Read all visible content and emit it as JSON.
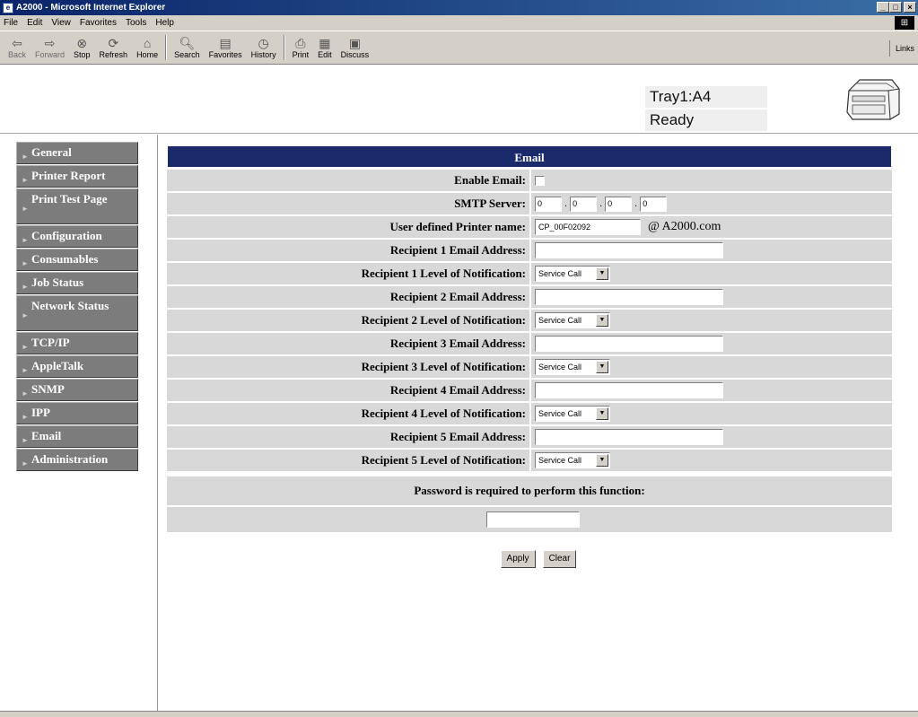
{
  "window": {
    "title": "A2000 - Microsoft Internet Explorer"
  },
  "menu": [
    "File",
    "Edit",
    "View",
    "Favorites",
    "Tools",
    "Help"
  ],
  "toolbar": {
    "buttons": [
      {
        "label": "Back",
        "icon": "back-arrow-icon"
      },
      {
        "label": "Forward",
        "icon": "forward-arrow-icon"
      },
      {
        "label": "Stop",
        "icon": "stop-icon"
      },
      {
        "label": "Refresh",
        "icon": "refresh-icon"
      },
      {
        "label": "Home",
        "icon": "home-icon"
      },
      {
        "label": "Search",
        "icon": "search-icon"
      },
      {
        "label": "Favorites",
        "icon": "favorites-icon"
      },
      {
        "label": "History",
        "icon": "history-icon"
      },
      {
        "label": "Print",
        "icon": "print-icon"
      },
      {
        "label": "Edit",
        "icon": "edit-icon"
      },
      {
        "label": "Discuss",
        "icon": "discuss-icon"
      }
    ],
    "links": "Links"
  },
  "status": {
    "tray": "Tray1:A4",
    "state": "Ready"
  },
  "nav": [
    "General",
    "Printer Report",
    "Print Test Page",
    "Configuration",
    "Consumables",
    "Job Status",
    "Network Status",
    "TCP/IP",
    "AppleTalk",
    "SNMP",
    "IPP",
    "Email",
    "Administration"
  ],
  "form": {
    "title": "Email",
    "enable_email_label": "Enable Email:",
    "smtp_label": "SMTP Server:",
    "smtp_octets": [
      "0",
      "0",
      "0",
      "0"
    ],
    "printer_name_label": "User defined Printer name:",
    "printer_name_value": "CP_00F02092",
    "domain": "@ A2000.com",
    "recipients": [
      {
        "address_label": "Recipient 1 Email Address:",
        "level_label": "Recipient 1 Level of Notification:",
        "level": "Service Call"
      },
      {
        "address_label": "Recipient 2 Email Address:",
        "level_label": "Recipient 2 Level of Notification:",
        "level": "Service Call"
      },
      {
        "address_label": "Recipient 3 Email Address:",
        "level_label": "Recipient 3 Level of Notification:",
        "level": "Service Call"
      },
      {
        "address_label": "Recipient 4 Email Address:",
        "level_label": "Recipient 4 Level of Notification:",
        "level": "Service Call"
      },
      {
        "address_label": "Recipient 5 Email Address:",
        "level_label": "Recipient 5 Level of Notification:",
        "level": "Service Call"
      }
    ],
    "password_label": "Password is required to perform this function:",
    "apply": "Apply",
    "clear": "Clear"
  }
}
